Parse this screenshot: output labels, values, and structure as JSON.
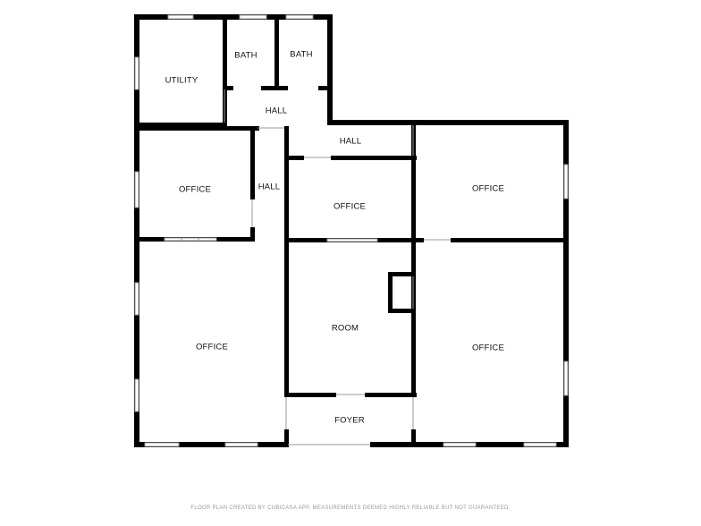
{
  "rooms": {
    "utility": "UTILITY",
    "bath_1": "BATH",
    "bath_2": "BATH",
    "hall_top": "HALL",
    "hall_mid": "HALL",
    "hall_vertical": "HALL",
    "office_left_small": "OFFICE",
    "office_center": "OFFICE",
    "office_right_top": "OFFICE",
    "office_left_large": "OFFICE",
    "room": "ROOM",
    "office_right_bottom": "OFFICE",
    "foyer": "FOYER"
  },
  "footer": "FLOOR PLAN CREATED BY CUBICASA APP. MEASUREMENTS DEEMED HIGHLY RELIABLE BUT NOT GUARANTEED.",
  "colors": {
    "wall": "#000000",
    "window": "#9a9a9a",
    "background": "#ffffff"
  }
}
